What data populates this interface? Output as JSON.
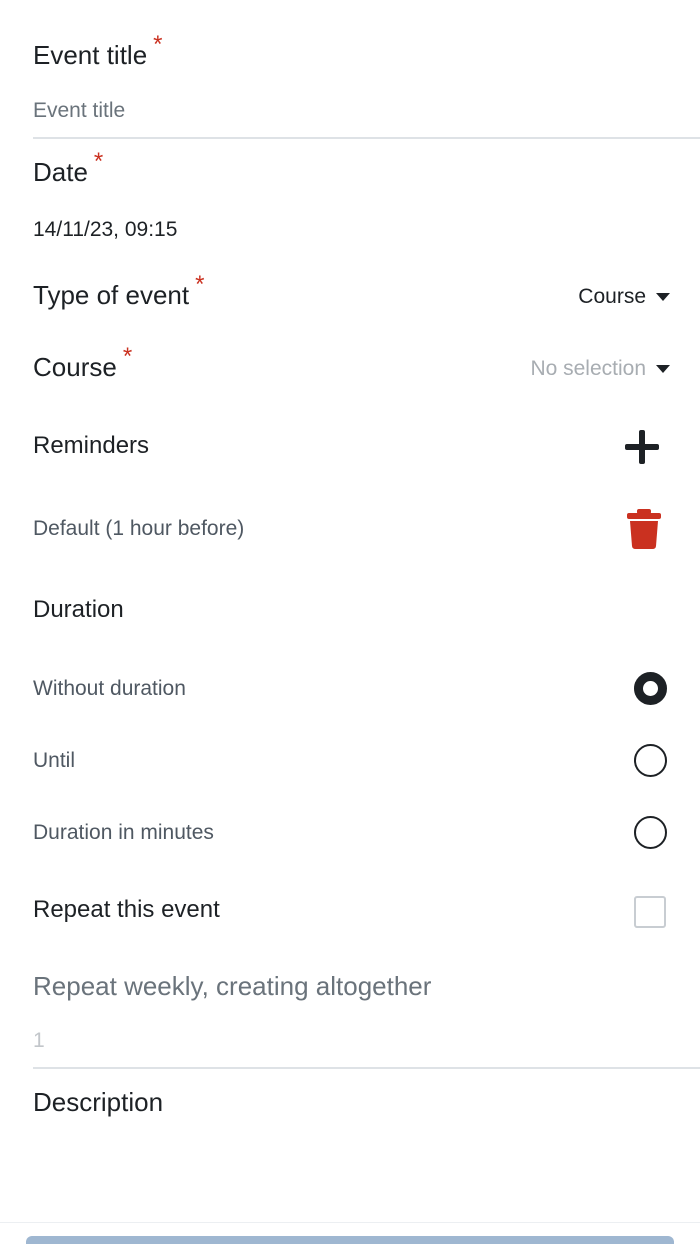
{
  "form": {
    "event_title": {
      "label": "Event title",
      "required_mark": "*",
      "placeholder": "Event title"
    },
    "date": {
      "label": "Date",
      "required_mark": "*",
      "value": "14/11/23, 09:15"
    },
    "type_of_event": {
      "label": "Type of event",
      "required_mark": "*",
      "value": "Course"
    },
    "course": {
      "label": "Course",
      "required_mark": "*",
      "value": "No selection"
    },
    "reminders": {
      "label": "Reminders",
      "items": [
        "Default (1 hour before)"
      ]
    },
    "duration": {
      "label": "Duration",
      "options": [
        "Without duration",
        "Until",
        "Duration in minutes"
      ],
      "selected": "Without duration"
    },
    "repeat": {
      "label": "Repeat this event",
      "checked": false
    },
    "repeat_weekly": {
      "label": "Repeat weekly, creating altogether",
      "placeholder": "1"
    },
    "description": {
      "label": "Description"
    }
  },
  "icons": {
    "add": "plus-icon",
    "delete": "trash-icon",
    "dropdown": "caret-down-icon"
  },
  "colors": {
    "required": "#ca3120",
    "delete": "#ca3120",
    "text": "#1d2125",
    "muted": "#6a737b",
    "save_button": "#9fb7d1"
  }
}
